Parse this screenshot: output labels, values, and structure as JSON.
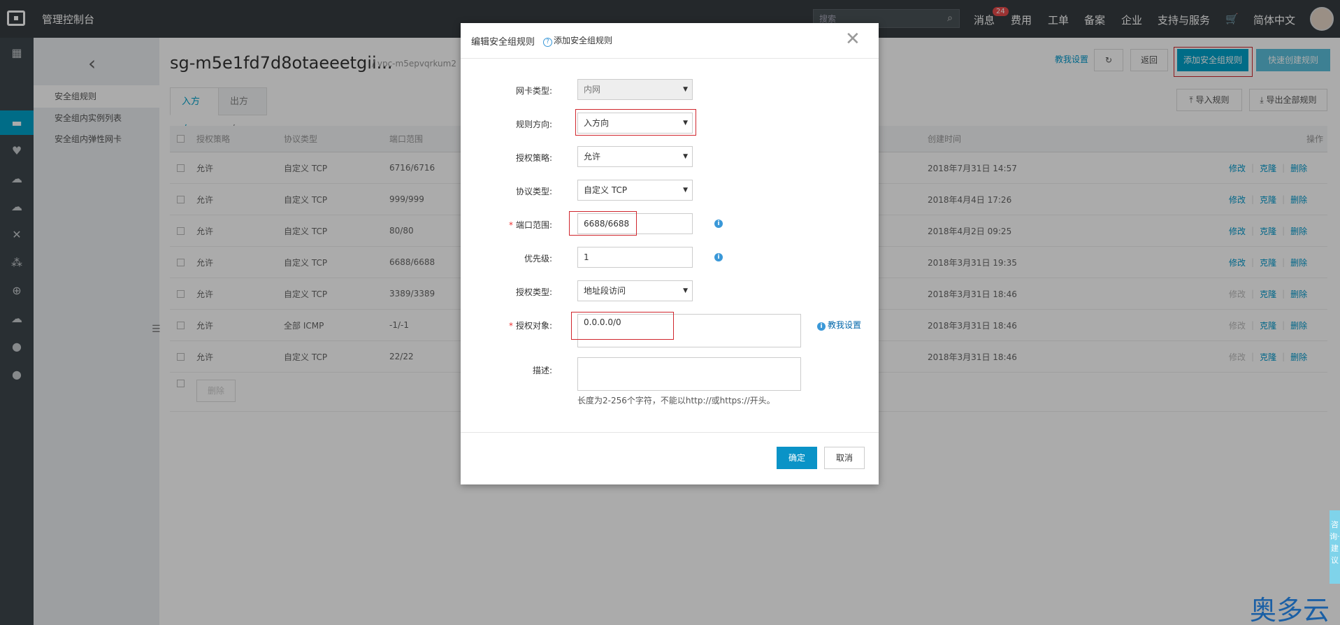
{
  "topbar": {
    "title": "管理控制台",
    "search_placeholder": "搜索",
    "messages_label": "消息",
    "messages_badge": "24",
    "nav": [
      "费用",
      "工单",
      "备案",
      "企业",
      "支持与服务"
    ],
    "language": "简体中文"
  },
  "subsidebar": {
    "items": [
      "安全组规则",
      "安全组内实例列表",
      "安全组内弹性网卡"
    ]
  },
  "main": {
    "sg_name": "sg-m5e1fd7d8otaeeetgii...",
    "vpc": "/ vpc-m5epvqrkum2",
    "tabs": [
      "入方向",
      "出方向"
    ],
    "buttons": {
      "teach": "教我设置",
      "back": "返回",
      "add_rule": "添加安全组规则",
      "quick_create": "快速创建规则",
      "import": "导入规则",
      "export": "导出全部规则",
      "delete": "删除"
    },
    "table": {
      "headers": [
        "授权策略",
        "协议类型",
        "端口范围",
        "创建时间",
        "操作"
      ],
      "rows": [
        {
          "policy": "允许",
          "protocol": "自定义 TCP",
          "port": "6716/6716",
          "created": "2018年7月31日 14:57"
        },
        {
          "policy": "允许",
          "protocol": "自定义 TCP",
          "port": "999/999",
          "created": "2018年4月4日 17:26"
        },
        {
          "policy": "允许",
          "protocol": "自定义 TCP",
          "port": "80/80",
          "created": "2018年4月2日 09:25"
        },
        {
          "policy": "允许",
          "protocol": "自定义 TCP",
          "port": "6688/6688",
          "created": "2018年3月31日 19:35"
        },
        {
          "policy": "允许",
          "protocol": "自定义 TCP",
          "port": "3389/3389",
          "created": "2018年3月31日 18:46"
        },
        {
          "policy": "允许",
          "protocol": "全部 ICMP",
          "port": "-1/-1",
          "created": "2018年3月31日 18:46"
        },
        {
          "policy": "允许",
          "protocol": "自定义 TCP",
          "port": "22/22",
          "created": "2018年3月31日 18:46"
        }
      ],
      "ops": [
        "修改",
        "克隆",
        "删除"
      ]
    }
  },
  "modal": {
    "title": "编辑安全组规则",
    "help_link": "添加安全组规则",
    "fields": {
      "nic_type_label": "网卡类型:",
      "nic_type_value": "内网",
      "direction_label": "规则方向:",
      "direction_value": "入方向",
      "policy_label": "授权策略:",
      "policy_value": "允许",
      "protocol_label": "协议类型:",
      "protocol_value": "自定义 TCP",
      "port_label": "端口范围:",
      "port_value": "6688/6688",
      "priority_label": "优先级:",
      "priority_value": "1",
      "auth_type_label": "授权类型:",
      "auth_type_value": "地址段访问",
      "auth_object_label": "授权对象:",
      "auth_object_value": "0.0.0.0/0",
      "teach_link": "教我设置",
      "desc_label": "描述:",
      "desc_hint": "长度为2-256个字符，不能以http://或https://开头。"
    },
    "ok": "确定",
    "cancel": "取消"
  },
  "feedback": "咨询·建议",
  "watermark": "奥多云",
  "colors": {
    "accent": "#00a2ca",
    "highlight_box": "#d0262d",
    "topbar": "#373d41"
  }
}
